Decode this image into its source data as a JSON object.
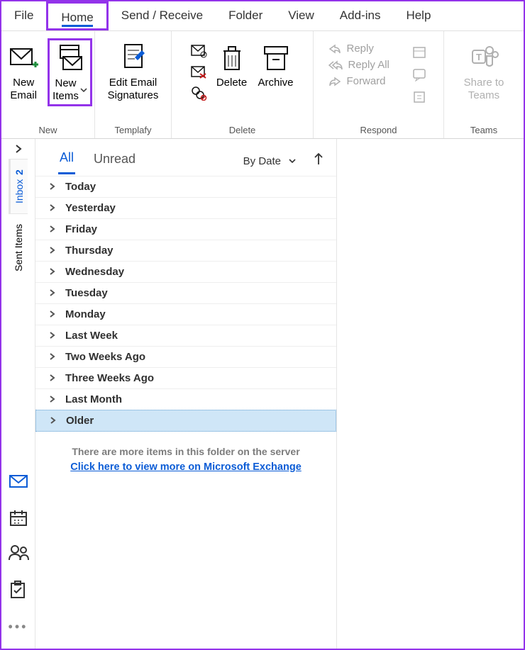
{
  "tabs": {
    "file": "File",
    "home": "Home",
    "sendreceive": "Send / Receive",
    "folder": "Folder",
    "view": "View",
    "addins": "Add-ins",
    "help": "Help"
  },
  "ribbon": {
    "new": {
      "label": "New",
      "newEmail": "New\nEmail",
      "newItems": "New\nItems"
    },
    "templafy": {
      "label": "Templafy",
      "editSig": "Edit Email\nSignatures"
    },
    "delete": {
      "label": "Delete",
      "delete": "Delete",
      "archive": "Archive"
    },
    "respond": {
      "label": "Respond",
      "reply": "Reply",
      "replyAll": "Reply All",
      "forward": "Forward"
    },
    "teams": {
      "label": "Teams",
      "shareTo": "Share to\nTeams"
    }
  },
  "rail": {
    "inbox": "Inbox",
    "inboxCount": "2",
    "sent": "Sent Items"
  },
  "list": {
    "viewAll": "All",
    "viewUnread": "Unread",
    "sortBy": "By Date",
    "groups": [
      "Today",
      "Yesterday",
      "Friday",
      "Thursday",
      "Wednesday",
      "Tuesday",
      "Monday",
      "Last Week",
      "Two Weeks Ago",
      "Three Weeks Ago",
      "Last Month",
      "Older"
    ],
    "moreNote": "There are more items in this folder on the server",
    "moreLink": "Click here to view more on Microsoft Exchange"
  }
}
